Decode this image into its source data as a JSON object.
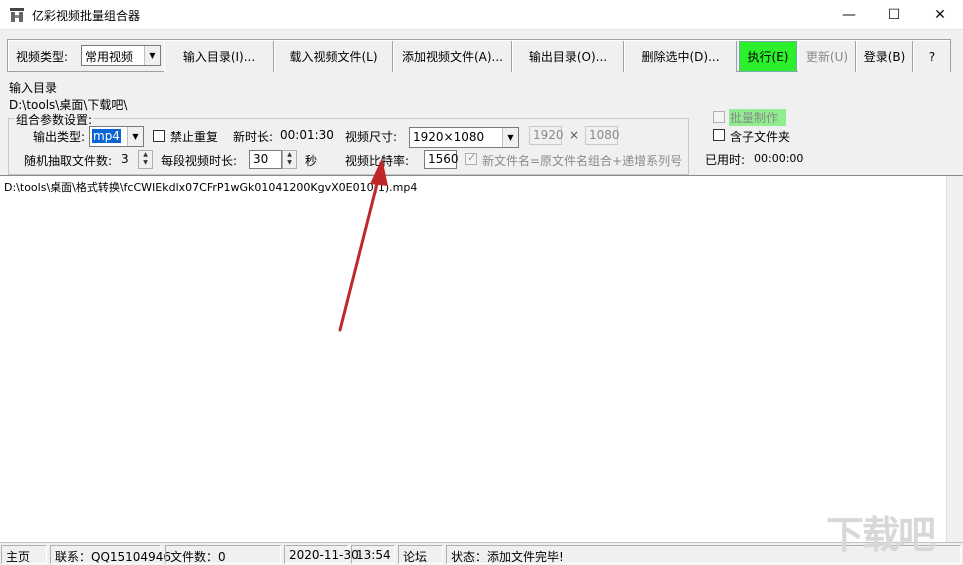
{
  "window": {
    "title": "亿彩视频批量组合器",
    "minimize": "—",
    "maximize": "☐",
    "close": "✕"
  },
  "toolbar": {
    "video_type_label": "视频类型:",
    "video_type_value": "常用视频",
    "input_dir": "输入目录(I)...",
    "load_file": "载入视频文件(L)",
    "add_file": "添加视频文件(A)...",
    "output_dir": "输出目录(O)...",
    "delete_selected": "删除选中(D)...",
    "execute": "执行(E)",
    "update": "更新(U)",
    "login": "登录(B)",
    "help": "?"
  },
  "input_dir": {
    "label": "输入目录",
    "path": "D:\\tools\\桌面\\下载吧\\"
  },
  "params": {
    "group_title": "组合参数设置:",
    "output_type_label": "输出类型:",
    "output_type_value": "mp4",
    "no_repeat_label": "禁止重复",
    "new_duration_label": "新时长:",
    "new_duration_value": "00:01:30",
    "video_size_label": "视频尺寸:",
    "video_size_value": "1920×1080",
    "width_value": "1920",
    "times_sign": "×",
    "height_value": "1080",
    "random_files_label": "随机抽取文件数:",
    "random_files_value": "3",
    "segment_duration_label": "每段视频时长:",
    "segment_duration_value": "30",
    "seconds_unit": "秒",
    "bitrate_label": "视频比特率:",
    "bitrate_value": "1560",
    "filename_rule_label": "新文件名=原文件名组合+递增系列号"
  },
  "right_options": {
    "batch_label": "批量制作",
    "subfolder_label": "含子文件夹",
    "elapsed_label": "已用时:",
    "elapsed_value": "00:00:00"
  },
  "file_list": {
    "items": [
      "D:\\tools\\桌面\\格式转换\\fcCWIEkdlx07CFrP1wGk01041200KgvX0E010(1).mp4"
    ]
  },
  "statusbar": {
    "home": "主页",
    "contact": "联系：QQ15104946",
    "file_count": "文件数：0",
    "date": "2020-11-30",
    "time": "13:54",
    "forum": "论坛",
    "status": "状态：添加文件完毕!"
  },
  "colors": {
    "execute_bg": "#2cf02c",
    "batch_highlight": "#90ee90",
    "arrow": "#c02828"
  }
}
